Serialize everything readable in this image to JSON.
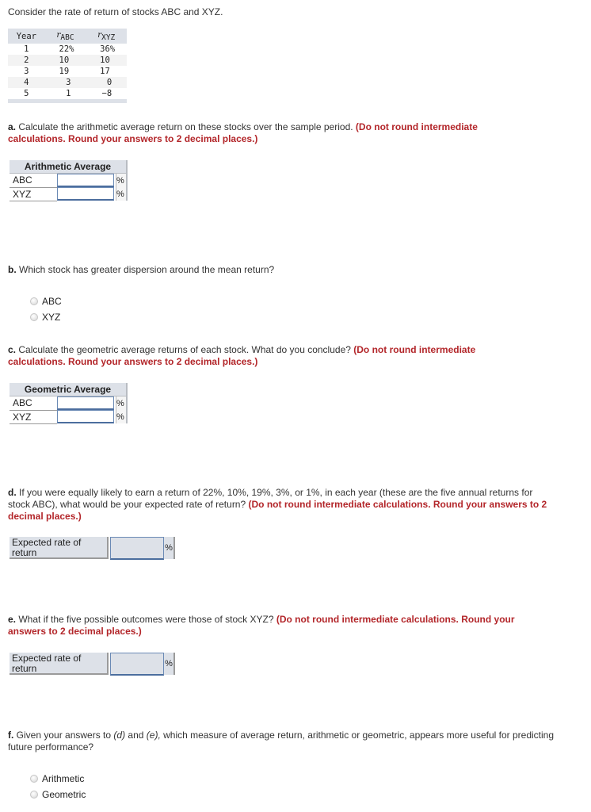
{
  "intro": "Consider the rate of return of stocks ABC and XYZ.",
  "data_table": {
    "headers": {
      "year": "Year",
      "r": "r",
      "abc_sub": "ABC",
      "xyz_sub": "XYZ"
    },
    "rows": [
      {
        "year": "1",
        "abc": "22%",
        "xyz": "36%"
      },
      {
        "year": "2",
        "abc": "10",
        "xyz": "10"
      },
      {
        "year": "3",
        "abc": "19",
        "xyz": "17"
      },
      {
        "year": "4",
        "abc": "3",
        "xyz": "0"
      },
      {
        "year": "5",
        "abc": "1",
        "xyz": "−8"
      }
    ]
  },
  "part_a": {
    "letter": "a.",
    "text": " Calculate the arithmetic average return on these stocks over the sample period. ",
    "note": "(Do not round intermediate calculations. Round your answers to 2 decimal places.)",
    "table_header": "Arithmetic Average",
    "rows": [
      {
        "label": "ABC",
        "value": "",
        "unit": "%"
      },
      {
        "label": "XYZ",
        "value": "",
        "unit": "%"
      }
    ]
  },
  "part_b": {
    "letter": "b.",
    "text": " Which stock has greater dispersion around the mean return?",
    "options": [
      "ABC",
      "XYZ"
    ]
  },
  "part_c": {
    "letter": "c.",
    "text": " Calculate the geometric average returns of each stock. What do you conclude? ",
    "note": "(Do not round intermediate calculations. Round your answers to 2 decimal places.)",
    "table_header": "Geometric Average",
    "rows": [
      {
        "label": "ABC",
        "value": "",
        "unit": "%"
      },
      {
        "label": "XYZ",
        "value": "",
        "unit": "%"
      }
    ]
  },
  "part_d": {
    "letter": "d.",
    "text": " If you were equally likely to earn a return of 22%, 10%, 19%, 3%, or 1%, in each year (these are the five annual returns for stock ABC), what would be your expected rate of return? ",
    "note": "(Do not round intermediate calculations. Round your answers to 2 decimal places.)",
    "label_line1": "Expected rate of",
    "label_line2": "return",
    "value": "",
    "unit": "%"
  },
  "part_e": {
    "letter": "e.",
    "text": " What if the five possible outcomes were those of stock XYZ? ",
    "note": "(Do not round intermediate calculations. Round your answers to 2 decimal places.)",
    "label_line1": "Expected rate of",
    "label_line2": "return",
    "value": "",
    "unit": "%"
  },
  "part_f": {
    "letter": "f.",
    "text_1": " Given your answers to ",
    "ref_d": "(d)",
    "text_2": " and ",
    "ref_e": "(e),",
    "text_3": " which measure of average return, arithmetic or geometric, appears more useful for predicting future performance?",
    "options": [
      "Arithmetic",
      "Geometric"
    ]
  }
}
